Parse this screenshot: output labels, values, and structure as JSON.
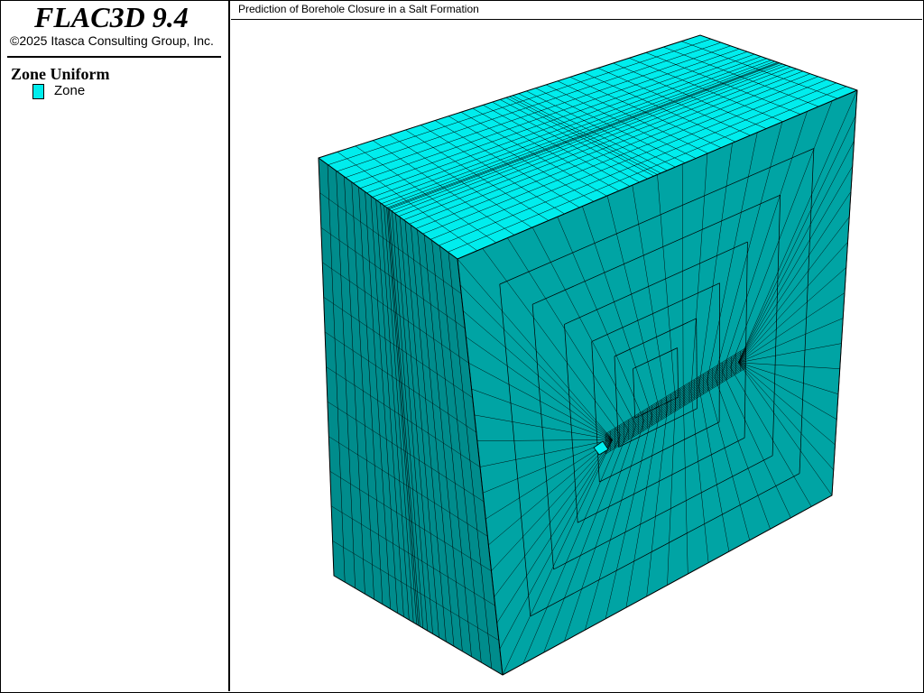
{
  "app": {
    "title": "FLAC3D 9.4",
    "copyright": "©2025 Itasca Consulting Group, Inc."
  },
  "legend": {
    "title": "Zone Uniform",
    "items": [
      {
        "label": "Zone",
        "color": "#00eded"
      }
    ]
  },
  "plot": {
    "title": "Prediction of Borehole Closure in a Salt Formation"
  },
  "colors": {
    "top_face": "#00eded",
    "left_face": "#008c8c",
    "front_face": "#00a4a4",
    "borehole": "#00eded",
    "mesh_line": "#000000"
  }
}
